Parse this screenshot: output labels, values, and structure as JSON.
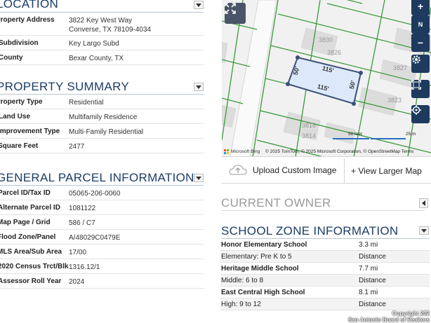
{
  "sections": {
    "location": "LOCATION",
    "property_summary": "PROPERTY SUMMARY",
    "general_parcel": "GENERAL PARCEL INFORMATION",
    "current_owner": "CURRENT OWNER",
    "school_zone": "SCHOOL ZONE INFORMATION"
  },
  "location": [
    {
      "label": "Property Address",
      "value": "3822 Key West Way",
      "value2": "Converse, TX 78109-4034"
    },
    {
      "label": "Subdivision",
      "value": "Key Largo Subd"
    },
    {
      "label": "County",
      "value": "Bexar County, TX"
    }
  ],
  "summary": [
    {
      "label": "Property Type",
      "value": "Residential"
    },
    {
      "label": "Land Use",
      "value": "Multifamily Residence"
    },
    {
      "label": "Improvement Type",
      "value": "Multi-Family Residential"
    },
    {
      "label": "Square Feet",
      "value": "2477"
    }
  ],
  "parcel": [
    {
      "label": "Parcel ID/Tax ID",
      "value": "05065-206-0060"
    },
    {
      "label": "Alternate Parcel ID",
      "value": "1081122"
    },
    {
      "label": "Map Page / Grid",
      "value": "586 / C7"
    },
    {
      "label": "Flood Zone/Panel",
      "value": "A/48029C0479E"
    },
    {
      "label": "MLS Area/Sub Area",
      "value": "17/00"
    },
    {
      "label": "2020 Census Trct/Blk",
      "value": "1316.12/1"
    },
    {
      "label": "Assessor Roll Year",
      "value": "2024"
    }
  ],
  "map": {
    "lot_numbers": [
      "3830",
      "3826",
      "3827",
      "3823",
      "3818",
      "3814"
    ],
    "dims": {
      "top": "115'",
      "bottom": "115'",
      "left": "50'",
      "right": "50'"
    },
    "scale_feet": "50 feet",
    "scale_m": "25 m",
    "credit": "© 2025 TomTom, © 2025 Microsoft Corporation, © OpenStreetMap  Terms",
    "bing": "Microsoft Bing",
    "controls": {
      "zoom_in": "+",
      "zoom_out": "−",
      "north": "N"
    },
    "upload_label": "Upload Custom Image",
    "larger_label": "+ View Larger Map"
  },
  "schools": [
    {
      "name": "Honor Elementary School",
      "dist": "3.3 mi",
      "grades": "Elementary: Pre K to 5",
      "dist_label": "Distance"
    },
    {
      "name": "Heritage Middle School",
      "dist": "7.7 mi",
      "grades": "Middle: 6 to 8",
      "dist_label": "Distance"
    },
    {
      "name": "East Central High School",
      "dist": "8.1 mi",
      "grades": "High: 9 to 12",
      "dist_label": "Distance"
    }
  ],
  "copyright": {
    "line1": "Copyright 202",
    "line2": "San Antonio Board of Realtors"
  },
  "colors": {
    "header_text": "#1b3d66",
    "map_controls": "#1e3a5f",
    "parcel_line": "#2e9a2e",
    "selected_lot": "#dce9fb"
  }
}
